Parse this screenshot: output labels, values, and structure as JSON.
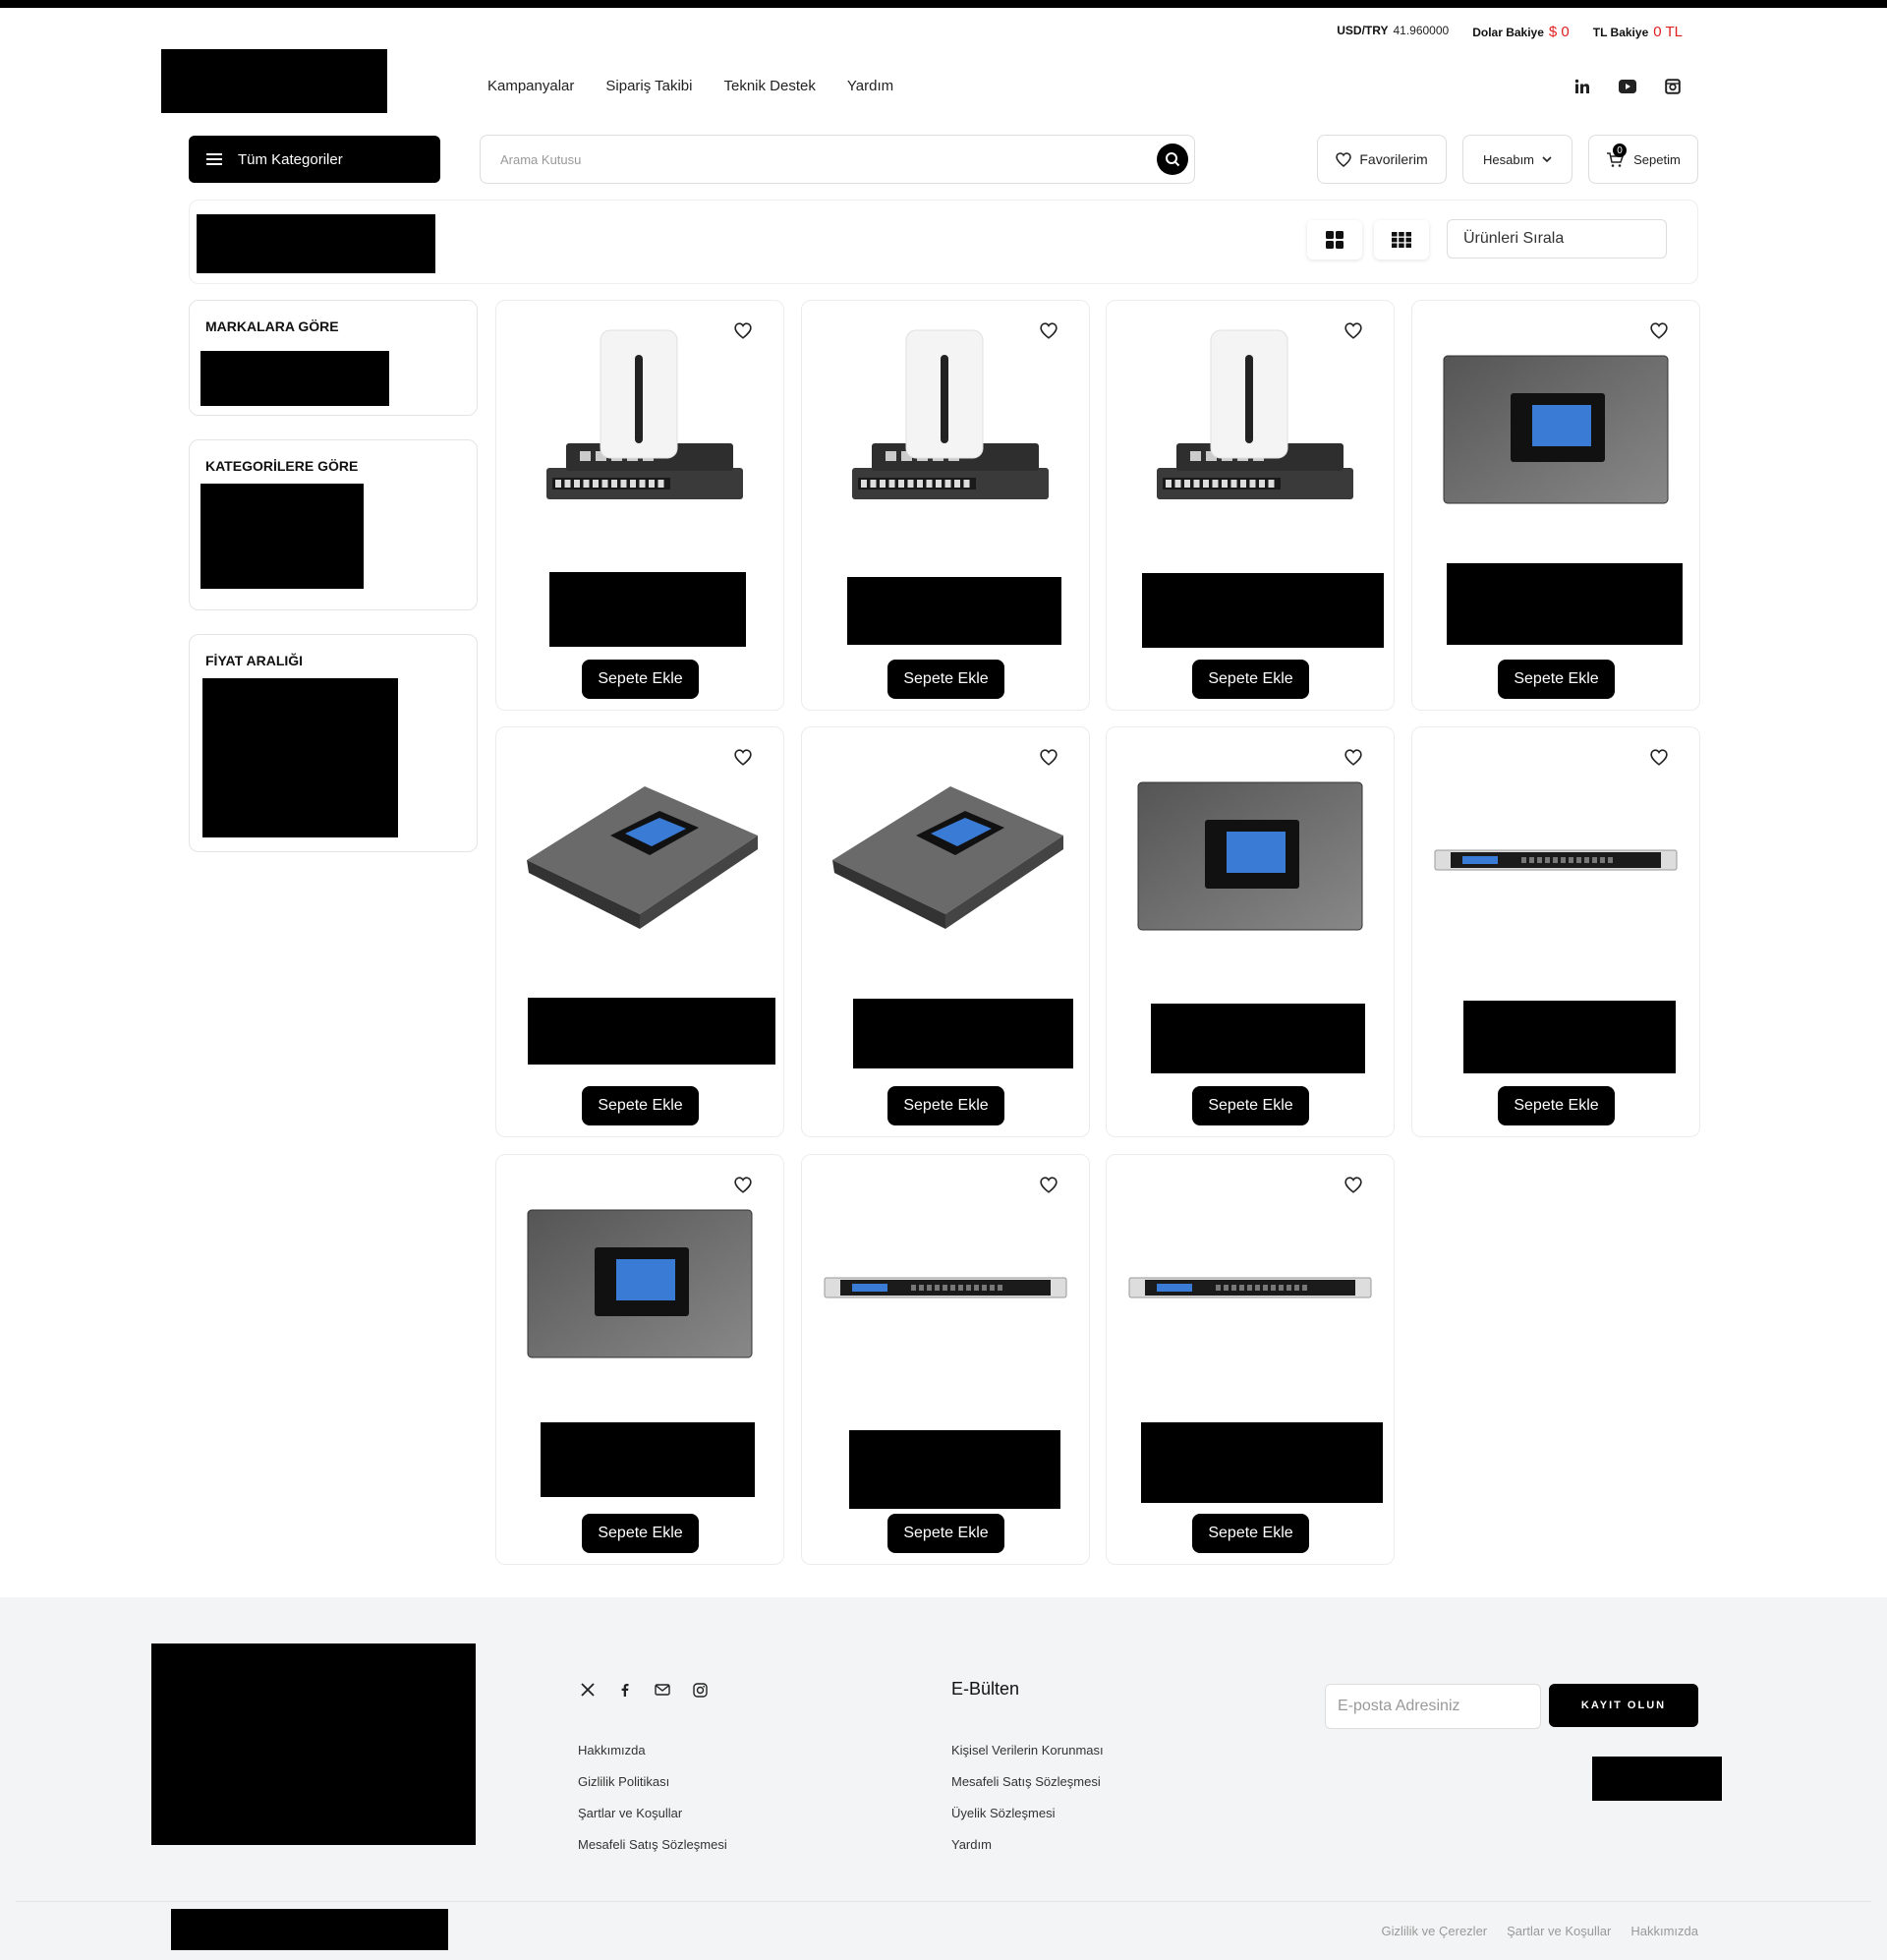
{
  "rates": [
    {
      "label": "USD/TRY",
      "value": "41.960000",
      "highlight": false
    },
    {
      "label": "Dolar Bakiye",
      "value": "$ 0",
      "highlight": true
    },
    {
      "label": "TL Bakiye",
      "value": "0 TL",
      "highlight": true
    }
  ],
  "nav": [
    "Kampanyalar",
    "Sipariş Takibi",
    "Teknik Destek",
    "Yardım"
  ],
  "social_top": [
    "linkedin-icon",
    "youtube-icon",
    "instagram-icon"
  ],
  "header": {
    "categories_label": "Tüm Kategoriler",
    "search_placeholder": "Arama Kutusu",
    "favorites_label": "Favorilerim",
    "account_label": "Hesabım",
    "cart_label": "Sepetim",
    "cart_count": "0"
  },
  "toolbar": {
    "sort_label": "Ürünleri Sırala"
  },
  "filters": {
    "brands_title": "MARKALARA GÖRE",
    "categories_title": "KATEGORİLERE GÖRE",
    "price_title": "FİYAT ARALIĞI"
  },
  "product": {
    "add_label": "Sepete Ekle",
    "items": [
      {
        "image": "router-tower-icon"
      },
      {
        "image": "router-tower-icon"
      },
      {
        "image": "router-tower-icon"
      },
      {
        "image": "ip-pbx-front-icon"
      },
      {
        "image": "ip-pbx-angled-icon"
      },
      {
        "image": "ip-pbx-angled-icon"
      },
      {
        "image": "ip-pbx-front-icon"
      },
      {
        "image": "rack-unit-icon"
      },
      {
        "image": "ip-pbx-front-icon"
      },
      {
        "image": "rack-unit-icon"
      },
      {
        "image": "rack-unit-icon"
      }
    ]
  },
  "footer": {
    "social": [
      "x-icon",
      "facebook-icon",
      "mail-icon",
      "instagram-icon"
    ],
    "links_col1": [
      "Hakkımızda",
      "Gizlilik Politikası",
      "Şartlar ve Koşullar",
      "Mesafeli Satış Sözleşmesi"
    ],
    "links_col2": [
      "Kişisel Verilerin Korunması",
      "Mesafeli Satış Sözleşmesi",
      "Üyelik Sözleşmesi",
      "Yardım"
    ],
    "newsletter_title": "E-Bülten",
    "email_placeholder": "E-posta Adresiniz",
    "subscribe_label": "KAYIT OLUN",
    "bottom_links": [
      "Gizlilik ve Çerezler",
      "Şartlar ve Koşullar",
      "Hakkımızda"
    ]
  },
  "colors": {
    "accent": "#000000",
    "balance_red": "#e02020",
    "footer_bg": "#f3f4f5"
  }
}
